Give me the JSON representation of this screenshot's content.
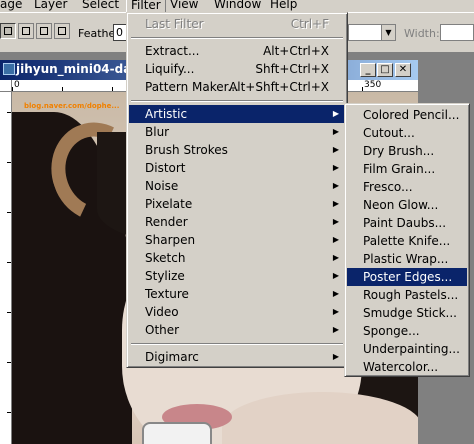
{
  "menubar": {
    "items": [
      {
        "label": "age"
      },
      {
        "label": "Layer"
      },
      {
        "label": "Select"
      },
      {
        "label": "Filter"
      },
      {
        "label": "View"
      },
      {
        "label": "Window"
      },
      {
        "label": "Help"
      }
    ]
  },
  "options": {
    "feather_label": "Feather:",
    "feather_value": "0",
    "width_label": "Width:"
  },
  "document": {
    "title": "jihyun_mini04-da",
    "ruler_labels": [
      "0",
      "350"
    ],
    "watermark": "blog.naver.com/dophe..."
  },
  "filter_menu": {
    "last_filter": {
      "label": "Last Filter",
      "shortcut": "Ctrl+F"
    },
    "top_items": [
      {
        "label": "Extract...",
        "shortcut": "Alt+Ctrl+X"
      },
      {
        "label": "Liquify...",
        "shortcut": "Shft+Ctrl+X"
      },
      {
        "label": "Pattern Maker...",
        "shortcut": "Alt+Shft+Ctrl+X"
      }
    ],
    "groups": [
      {
        "label": "Artistic"
      },
      {
        "label": "Blur"
      },
      {
        "label": "Brush Strokes"
      },
      {
        "label": "Distort"
      },
      {
        "label": "Noise"
      },
      {
        "label": "Pixelate"
      },
      {
        "label": "Render"
      },
      {
        "label": "Sharpen"
      },
      {
        "label": "Sketch"
      },
      {
        "label": "Stylize"
      },
      {
        "label": "Texture"
      },
      {
        "label": "Video"
      },
      {
        "label": "Other"
      }
    ],
    "bottom_items": [
      {
        "label": "Digimarc"
      }
    ],
    "highlight": "Artistic"
  },
  "artistic_menu": {
    "items": [
      {
        "label": "Colored Pencil..."
      },
      {
        "label": "Cutout..."
      },
      {
        "label": "Dry Brush..."
      },
      {
        "label": "Film Grain..."
      },
      {
        "label": "Fresco..."
      },
      {
        "label": "Neon Glow..."
      },
      {
        "label": "Paint Daubs..."
      },
      {
        "label": "Palette Knife..."
      },
      {
        "label": "Plastic Wrap..."
      },
      {
        "label": "Poster Edges..."
      },
      {
        "label": "Rough Pastels..."
      },
      {
        "label": "Smudge Stick..."
      },
      {
        "label": "Sponge..."
      },
      {
        "label": "Underpainting..."
      },
      {
        "label": "Watercolor..."
      }
    ],
    "highlight": "Poster Edges..."
  },
  "colors": {
    "menu_highlight": "#0a246a",
    "menu_bg": "#d4d0c8",
    "titlebar": "#0a246a"
  }
}
